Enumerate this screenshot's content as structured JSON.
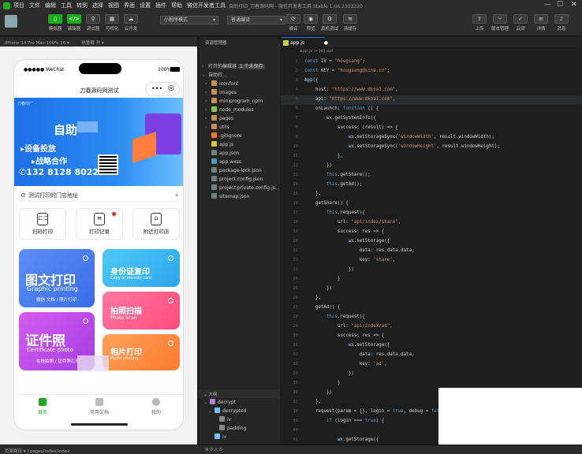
{
  "menu": [
    "项目",
    "文件",
    "编辑",
    "工具",
    "转到",
    "选择",
    "视图",
    "界面",
    "设置",
    "插件",
    "帮助",
    "微信开发者工具"
  ],
  "window_title": "自助打印_刀春源码网 - 微信开发者工具 Stable 1.06.2303220",
  "toolbar": {
    "left_buttons": [
      "模拟器",
      "编辑器",
      "调试器",
      "可视化",
      "云开发"
    ],
    "mode_select": "小程序模式",
    "compile_select": "普通编译",
    "mid_buttons": [
      "编译",
      "预览",
      "真机调试",
      "清缓存"
    ],
    "right_buttons": [
      "上传",
      "版本管理",
      "云测",
      "详情",
      "消息"
    ]
  },
  "simulator": {
    "device": "iPhone 14 Pro Max 100% 16 ▾",
    "hotreload": "热重载 开 ▾",
    "carrier": "●●●●● WeChat",
    "battery": "100%",
    "nav_title": "刀春源码网测试",
    "banner": {
      "logo": "刀春印厂",
      "headline": "自助",
      "line1": "▸设备投放",
      "line2": "▸战略合作",
      "phone": "132 8128 8022"
    },
    "address": "测试打印的门店地址",
    "quick": [
      "扫码打印",
      "打印记录",
      "附近打印店"
    ],
    "cards": [
      {
        "title": "图文打印",
        "sub": "Graphic printing",
        "desc": "微信 文档 / 照片打印",
        "color": "#4b7bec"
      },
      {
        "title": "身份证复印",
        "sub": "Copy of identity card",
        "color": "#39b9f0"
      },
      {
        "title": "证件照",
        "sub": "Certificate photo",
        "desc": "在线拍照 / 证件照打印",
        "color": "#c847e8"
      },
      {
        "title": "拍照扫描",
        "sub": "Photo Scan",
        "color": "#ff5a8a"
      },
      {
        "title": "相片打印",
        "sub": "Photo printing",
        "color": "#ff8a3d"
      }
    ],
    "tabs": [
      "首页",
      "常用文档",
      "我的"
    ]
  },
  "explorer": {
    "header": "资源管理器",
    "section": "打开的编辑器",
    "badge": "1 个未保存",
    "project": "自助打...",
    "items": [
      {
        "name": "iconfont",
        "type": "folder"
      },
      {
        "name": "images",
        "type": "folder"
      },
      {
        "name": "miniprogram_npm",
        "type": "folder"
      },
      {
        "name": "node_modules",
        "type": "folder"
      },
      {
        "name": "pages",
        "type": "folder"
      },
      {
        "name": "utils",
        "type": "folder"
      },
      {
        "name": ".gitignore",
        "type": "git"
      },
      {
        "name": "app.js",
        "type": "js"
      },
      {
        "name": "app.json",
        "type": "json"
      },
      {
        "name": "app.wxss",
        "type": "wxss"
      },
      {
        "name": "package-lock.json",
        "type": "json"
      },
      {
        "name": "project.config.json",
        "type": "json"
      },
      {
        "name": "project.private.config.js...",
        "type": "json"
      },
      {
        "name": "sitemap.json",
        "type": "json"
      }
    ],
    "outline_header": "大纲",
    "outline": [
      "decrypt",
      "decrypted",
      "iv",
      "padding",
      "iv"
    ]
  },
  "editor": {
    "tab": "app.js",
    "breadcrumb": "app.js  >  [e] api",
    "lines": [
      "const IV = \"hougsang\";",
      "const KEY = \"hougsang@sina.cn\";",
      "App({",
      "    host: \"https://www.dkoa1.com\",",
      "    api: \"https://www.dkoa1.com\",",
      "    onLaunch: function () {",
      "        wx.getSystemInfo({",
      "            success: (result) => {",
      "                wx.setStorageSync('windowWidth', result.windowWidth);",
      "                wx.setStorageSync('windowHeight', result.windowHeight);",
      "            },",
      "        })",
      "        this.getShare();",
      "        this.getAd();",
      "    },",
      "    getShare() {",
      "        this.request({",
      "            url: \"api/index/share\",",
      "            success: res => {",
      "                wx.setStorage({",
      "                    data: res.data.data,",
      "                    key: 'share',",
      "                })",
      "            }",
      "        })",
      "    },",
      "    getAd() {",
      "        this.request({",
      "            url: \"api/index/ad\",",
      "            success: res => {",
      "                wx.setStorage({",
      "                    data: res.data.data,",
      "                    key: 'ad',",
      "                })",
      "            }",
      "        })",
      "    },",
      "    request(param = {}, login = true, debug = false) {",
      "        if (login === true) {",
      "",
      "            wx.getStorage({"
    ]
  },
  "statusbar": {
    "path": "页面路径 ▾  |  pages/index/index",
    "errors": "⊗ 0 ⚠ 0"
  }
}
